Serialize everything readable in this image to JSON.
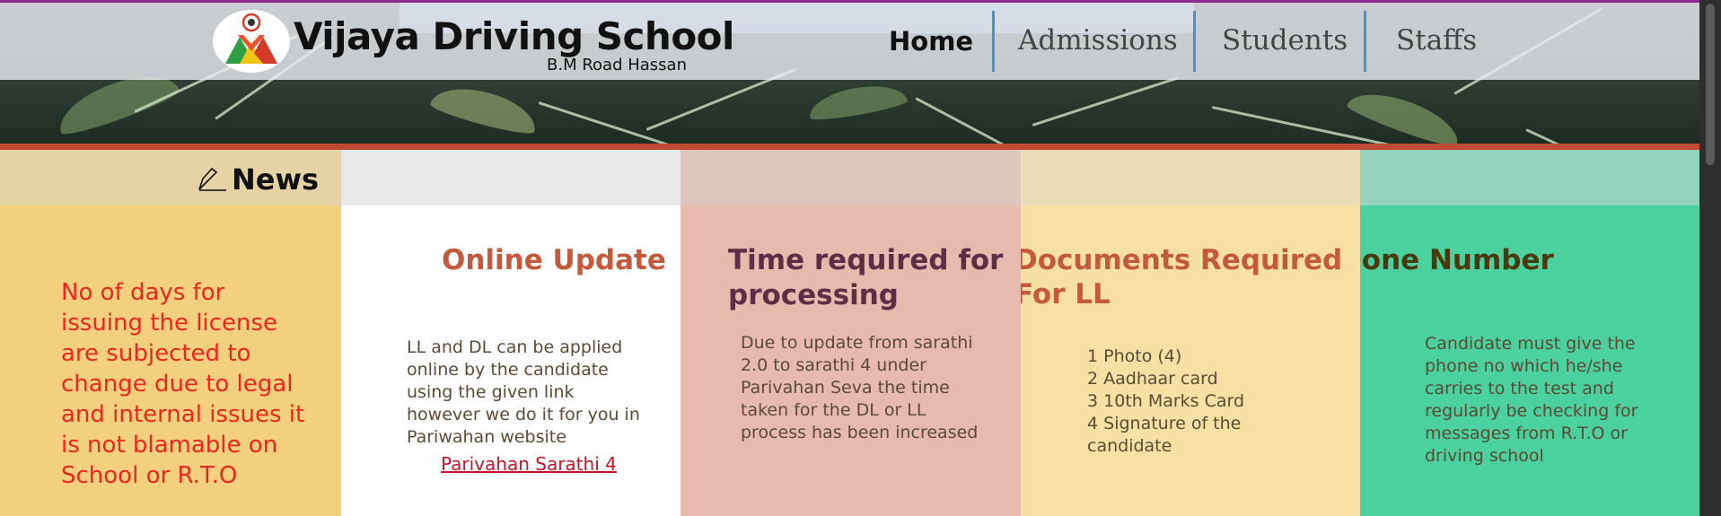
{
  "header": {
    "site_title": "Vijaya Driving School",
    "site_subtitle": "B.M Road Hassan",
    "nav": [
      "Home",
      "Admissions",
      "Students",
      "Staffs"
    ]
  },
  "news": {
    "label": "News",
    "text": "No of days for issuing the license are subjected to change due to legal and internal issues it is not blamable on School or R.T.O"
  },
  "cards": {
    "online": {
      "title": "Online Update",
      "body": "LL and DL can be applied online by the candidate using the given link however we do it for you in Pariwahan website",
      "link": "Parivahan Sarathi 4"
    },
    "time": {
      "title_line1": "Time required for",
      "title_line2": "processing",
      "body": "Due to update from sarathi 2.0 to sarathi 4 under Parivahan Seva the time taken for the DL or LL process has been increased"
    },
    "documents": {
      "title_line1": "Documents Required",
      "title_line2": "For LL",
      "items": [
        "1 Photo  (4)",
        "2 Aadhaar card",
        "3 10th Marks Card",
        "4 Signature of the candidate"
      ]
    },
    "phone": {
      "title": "Phone Number",
      "body": "Candidate must give the phone no which he/she carries to the test and regularly be checking for messages from R.T.O or driving school"
    }
  },
  "colors": {
    "news_bg": "#f3d07e",
    "online_bg": "#ffffff",
    "time_bg": "#e8b9ad",
    "docs_bg": "#f6e0a3",
    "phone_bg": "#4bd19f",
    "accent_red": "#c04a32",
    "nav_separator": "#4a90d9"
  },
  "icons": [
    "logo-icon",
    "pencil-icon"
  ]
}
